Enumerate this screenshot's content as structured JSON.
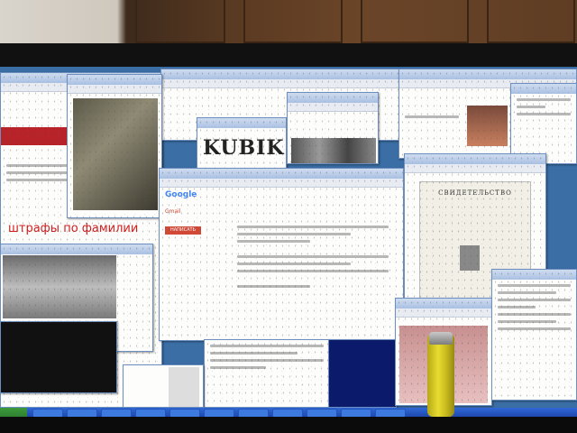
{
  "windows": {
    "gmail": {
      "logo": "Google",
      "label": "Gmail",
      "compose_label": "НАПИСАТЬ"
    },
    "kubik": {
      "logo": "KUBIK"
    },
    "shtrafy": {
      "headline": "штрафы по фамилии"
    },
    "certificate": {
      "title": "СВИДЕТЕЛЬСТВО"
    }
  },
  "colors": {
    "desktop": "#3a6ea5",
    "taskbar": "#1941a5",
    "titlebar": "#a9c0e2",
    "accent_red": "#d11d1d",
    "lighter": "#e8dc30"
  }
}
